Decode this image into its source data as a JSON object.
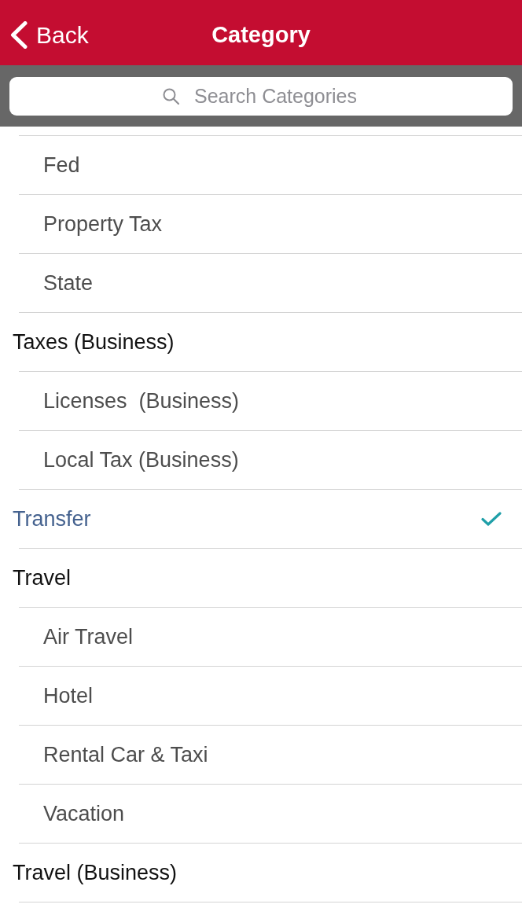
{
  "nav_bar": {
    "back_label": "Back",
    "title": "Category"
  },
  "search": {
    "placeholder": "Search Categories"
  },
  "categories": [
    {
      "children": [
        {
          "label": "Fed",
          "selected": false
        },
        {
          "label": "Property Tax",
          "selected": false
        },
        {
          "label": "State",
          "selected": false
        }
      ]
    },
    {
      "label": "Taxes (Business)",
      "selected": false,
      "children": [
        {
          "label": "Licenses  (Business)",
          "selected": false
        },
        {
          "label": "Local Tax (Business)",
          "selected": false
        }
      ]
    },
    {
      "label": "Transfer",
      "selected": true
    },
    {
      "label": "Travel",
      "selected": false,
      "children": [
        {
          "label": "Air Travel",
          "selected": false
        },
        {
          "label": "Hotel",
          "selected": false
        },
        {
          "label": "Rental Car & Taxi",
          "selected": false
        },
        {
          "label": "Vacation",
          "selected": false
        }
      ]
    },
    {
      "label": "Travel (Business)",
      "selected": false
    }
  ]
}
